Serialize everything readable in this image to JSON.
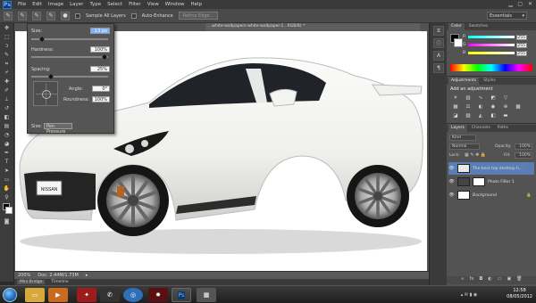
{
  "app": {
    "logo": "Ps"
  },
  "menubar": {
    "items": [
      "File",
      "Edit",
      "Image",
      "Layer",
      "Type",
      "Select",
      "Filter",
      "View",
      "Window",
      "Help"
    ]
  },
  "options": {
    "sample_all_layers": "Sample All Layers",
    "auto_enhance": "Auto-Enhance",
    "refine_edge": "Refine Edge...",
    "workspace": "Essentials"
  },
  "document": {
    "tab_title": "...white-wallpapers-white-wallpaper-1...RGB/8) *"
  },
  "brush_panel": {
    "size_label": "Size:",
    "size_value": "13 px",
    "hardness_label": "Hardness:",
    "hardness_value": "100%",
    "spacing_label": "Spacing:",
    "spacing_value": "25%",
    "angle_label": "Angle:",
    "angle_value": "0°",
    "roundness_label": "Roundness:",
    "roundness_value": "100%",
    "size_pressure_label": "Size:",
    "pen_pressure": "Pen Pressure",
    "hardness_level": 1.0,
    "spacing_level": 0.25
  },
  "statusbar": {
    "zoom": "200%",
    "doc_info": "Doc: 2.44M/1.73M"
  },
  "minibridge": {
    "tabs": [
      "Mini Bridge",
      "Timeline"
    ]
  },
  "panels": {
    "color": {
      "tabs": [
        "Color",
        "Swatches"
      ],
      "r": "255",
      "g": "255",
      "b": "255"
    },
    "adjustments": {
      "tabs": [
        "Adjustments",
        "Styles"
      ],
      "title": "Add an adjustment"
    },
    "layers": {
      "tabs": [
        "Layers",
        "Channels",
        "Paths"
      ],
      "kind": "Kind",
      "blend_mode": "Normal",
      "opacity_label": "Opacity:",
      "opacity": "100%",
      "lock_label": "Lock:",
      "fill_label": "Fill:",
      "fill": "100%",
      "rows": [
        {
          "name": "The best top desktop h..."
        },
        {
          "name": "Photo Filter 1"
        },
        {
          "name": "Background"
        }
      ]
    }
  },
  "taskbar": {
    "time": "12:58",
    "date": "08/05/2012"
  },
  "colors": {
    "accent": "#5a7db3",
    "car_body": "#f2f2ef"
  }
}
